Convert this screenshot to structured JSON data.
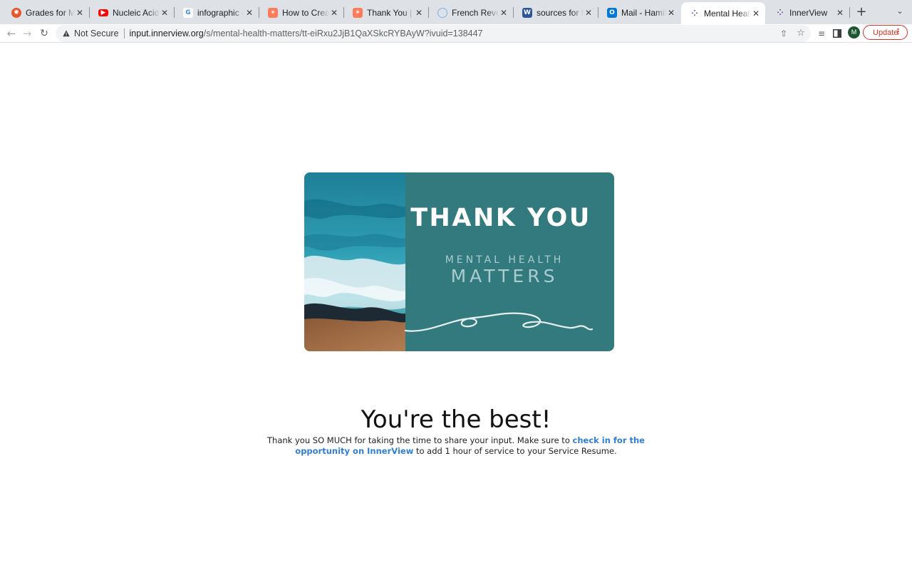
{
  "browser": {
    "tabs": [
      {
        "title": "Grades for Mia Ha",
        "icon": "canvas-icon",
        "color": "#e4572e"
      },
      {
        "title": "Nucleic Acids - Yo",
        "icon": "youtube-icon",
        "color": "#ff0000"
      },
      {
        "title": "infographic - Goo",
        "icon": "google-icon",
        "color": "#4285f4"
      },
      {
        "title": "How to Create an",
        "icon": "hubspot-icon",
        "color": "#ff7a59"
      },
      {
        "title": "Thank You | Free I",
        "icon": "hubspot-icon",
        "color": "#ff7a59"
      },
      {
        "title": "French Revolution",
        "icon": "globe-icon",
        "color": "#7fb2e5"
      },
      {
        "title": "sources for french",
        "icon": "word-icon",
        "color": "#2b579a"
      },
      {
        "title": "Mail - Hamilton, M",
        "icon": "outlook-icon",
        "color": "#0078d4"
      },
      {
        "title": "Mental Health Ma",
        "icon": "innerview-icon",
        "color": "#6b3fa0"
      },
      {
        "title": "InnerView",
        "icon": "innerview-icon",
        "color": "#6b3fa0"
      }
    ],
    "active_tab": 8,
    "close_glyph": "✕",
    "new_tab_glyph": "+",
    "security_label": "Not Secure",
    "url_host": "input.innerview.org",
    "url_path": "/s/mental-health-matters/tt-eiRxu2JjB1QaXSkcRYBAyW?ivuid=138447",
    "avatar_letter": "M",
    "update_label": "Update",
    "colors": {
      "tabstrip": "#dee1e6",
      "update_red": "#d93025",
      "avatar_green": "#1e5631"
    }
  },
  "banner": {
    "title": "THANK YOU",
    "subtitle_line1": "MENTAL HEALTH",
    "subtitle_line2": "MATTERS",
    "colors": {
      "teal": "#337a7e",
      "subtitle": "#a9ccd0"
    }
  },
  "content": {
    "headline": "You're the best!",
    "message_before": "Thank you SO MUCH for taking the time to share your input. Make sure to ",
    "message_link": "check in for the opportunity on InnerView",
    "message_after": " to add 1 hour of service to your Service Resume.",
    "link_color": "#2f7fd8"
  }
}
